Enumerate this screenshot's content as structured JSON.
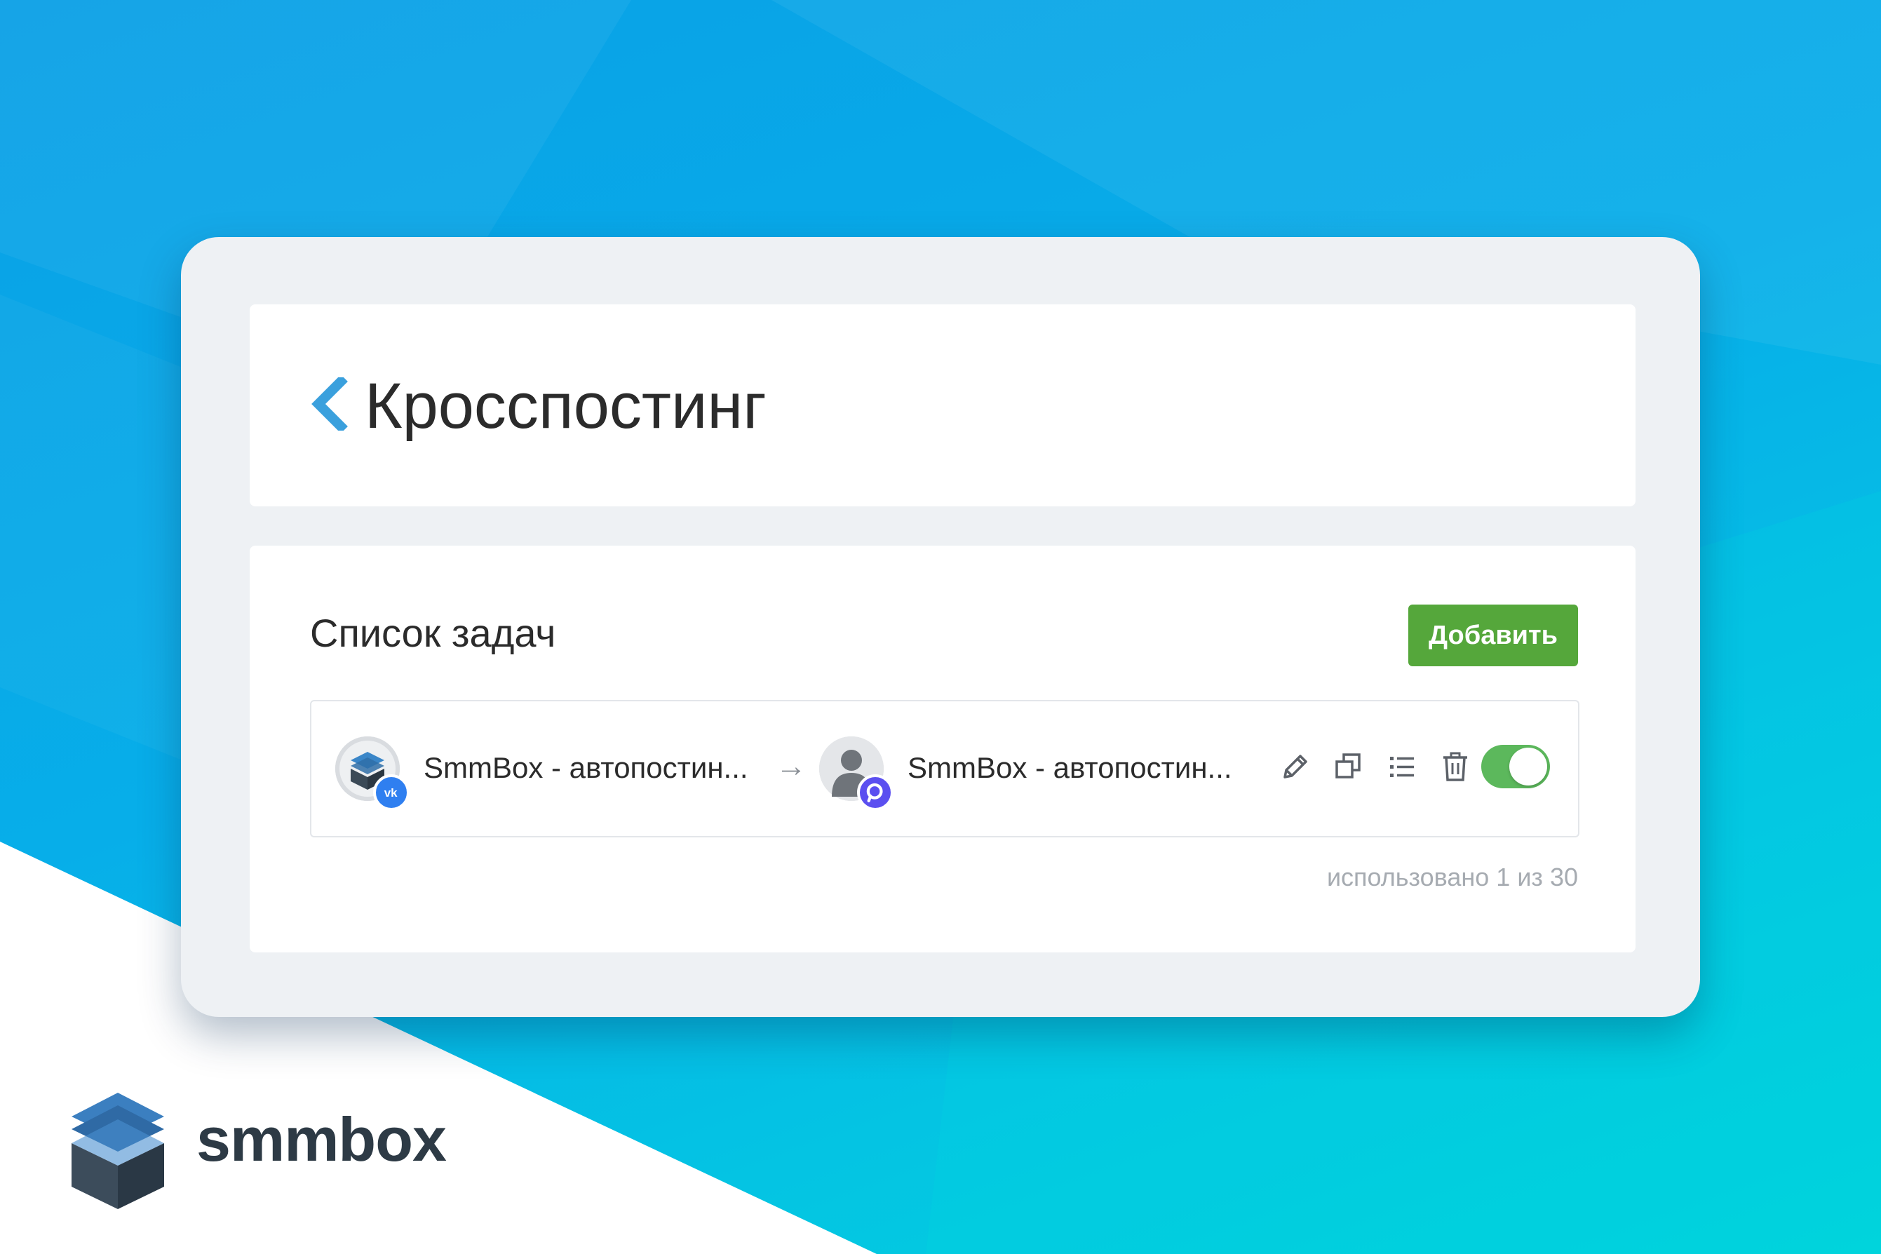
{
  "page": {
    "title": "Кросспостинг"
  },
  "tasks": {
    "section_title": "Список задач",
    "add_label": "Добавить",
    "rows": [
      {
        "source_name": "SmmBox - автопостин...",
        "source_network_icon": "vk-icon",
        "arrow": "→",
        "destination_name": "SmmBox - автопостин...",
        "destination_network_icon": "pinterest-badge-icon",
        "enabled": true
      }
    ],
    "usage_text": "использовано 1 из 30"
  },
  "brand": {
    "name": "smmbox"
  },
  "colors": {
    "accent_blue": "#3aa0dd",
    "add_button": "#55a73b",
    "toggle_on": "#5cb85c",
    "vk_blue": "#2f7ff0",
    "dest_badge": "#5b4ff0"
  }
}
